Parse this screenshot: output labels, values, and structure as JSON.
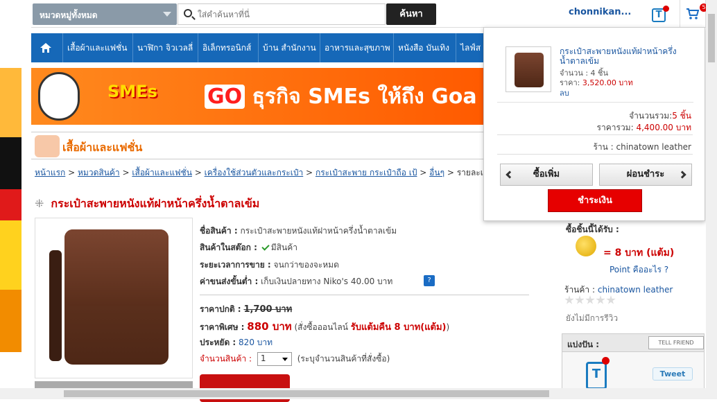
{
  "search": {
    "category": "หมวดหมู่ทั้งหมด",
    "placeholder": "ใส่คำค้นหาที่นี่",
    "button": "ค้นหา"
  },
  "header": {
    "username": "chonnikan...",
    "tcoin_icon": "t-logo-icon",
    "cart_icon": "cart-icon",
    "cart_count": "5"
  },
  "nav": {
    "items": [
      {
        "label": "เสื้อผ้าและแฟชั่น"
      },
      {
        "label": "นาฬิกา จิวเวลลี่"
      },
      {
        "label": "อิเล็กทรอนิกส์"
      },
      {
        "label": "บ้าน สำนักงาน"
      },
      {
        "label": "อาหารและสุขภาพ"
      },
      {
        "label": "หนังสือ บันเทิง"
      },
      {
        "label": "ไลฟ์ส"
      }
    ]
  },
  "banner": {
    "logo": "SMEs",
    "go": "GO",
    "text": "ธุรกิจ SMEs ให้ถึง",
    "goal": "Goa"
  },
  "category_heading": "เสื้อผ้าและแฟชั่น",
  "breadcrumb": [
    "หน้าแรก",
    "หมวดสินค้า",
    "เสื้อผ้าและแฟชั่น",
    "เครื่องใช้ส่วนตัวและกระเป๋า",
    "กระเป๋าสะพาย กระเป๋าถือ เป้",
    "อื่นๆ",
    "รายละเอียดสินค้า"
  ],
  "breadcrumb_sep": ">",
  "product": {
    "title": "กระเป๋าสะพายหนังแท้ฝาหน้าครึ่งน้ำตาลเข้ม",
    "name_label": "ชื่อสินค้า :",
    "name_value": "กระเป๋าสะพายหนังแท้ฝาหน้าครึ่งน้ำตาลเข้ม",
    "stock_label": "สินค้าในสต๊อก :",
    "stock_value": "มีสินค้า",
    "period_label": "ระยะเวลาการขาย :",
    "period_value": "จนกว่าของจะหมด",
    "shipping_label": "ค่าขนส่งขั้นต่ำ :",
    "shipping_value": "เก็บเงินปลายทาง Niko's 40.00 บาท",
    "help_icon": "?",
    "normal_label": "ราคาปกติ :",
    "normal_price": "1,700 บาท",
    "special_label": "ราคาพิเศษ :",
    "special_price": "880 บาท",
    "special_note_pre": "(สั่งซื้อออนไลน์",
    "special_note_red": "รับแต้มคืน 8 บาท(แต้ม)",
    "special_note_post": ")",
    "save_label": "ประหยัด :",
    "save_value": "820 บาท",
    "qty_label": "จำนวนสินค้า :",
    "qty_value": "1",
    "qty_note": "(ระบุจำนวนสินค้าที่สั่งซื้อ)"
  },
  "sidebar": {
    "points_label": "ซื้อชิ้นนี้ได้รับ :",
    "points_value": "= 8 บาท (แต้ม)",
    "points_link": "Point คืออะไร ?",
    "shop_label": "ร้านค้า :",
    "shop_name": "chinatown leather",
    "no_review": "ยังไม่มีการรีวิว",
    "share_label": "แบ่งปัน :",
    "tell_friend": "TELL FRIEND",
    "tweet": "Tweet"
  },
  "cart": {
    "item_name": "กระเป๋าสะพายหนังแท้ฝาหน้าครึ่งน้ำตาลเข้ม",
    "item_qty": "จำนวน : 4 ชิ้น",
    "item_price_label": "ราคา:",
    "item_price": "3,520.00 บาท",
    "item_remove": "ลบ",
    "total_qty_label": "จำนวนรวม:",
    "total_qty": "5 ชิ้น",
    "total_price_label": "ราคารวม:",
    "total_price": "4,400.00 บาท",
    "shop_label": "ร้าน :",
    "shop_name": "chinatown leather",
    "continue": "ซื้อเพิ่ม",
    "installment": "ผ่อนชำระ",
    "checkout": "ชำระเงิน"
  }
}
